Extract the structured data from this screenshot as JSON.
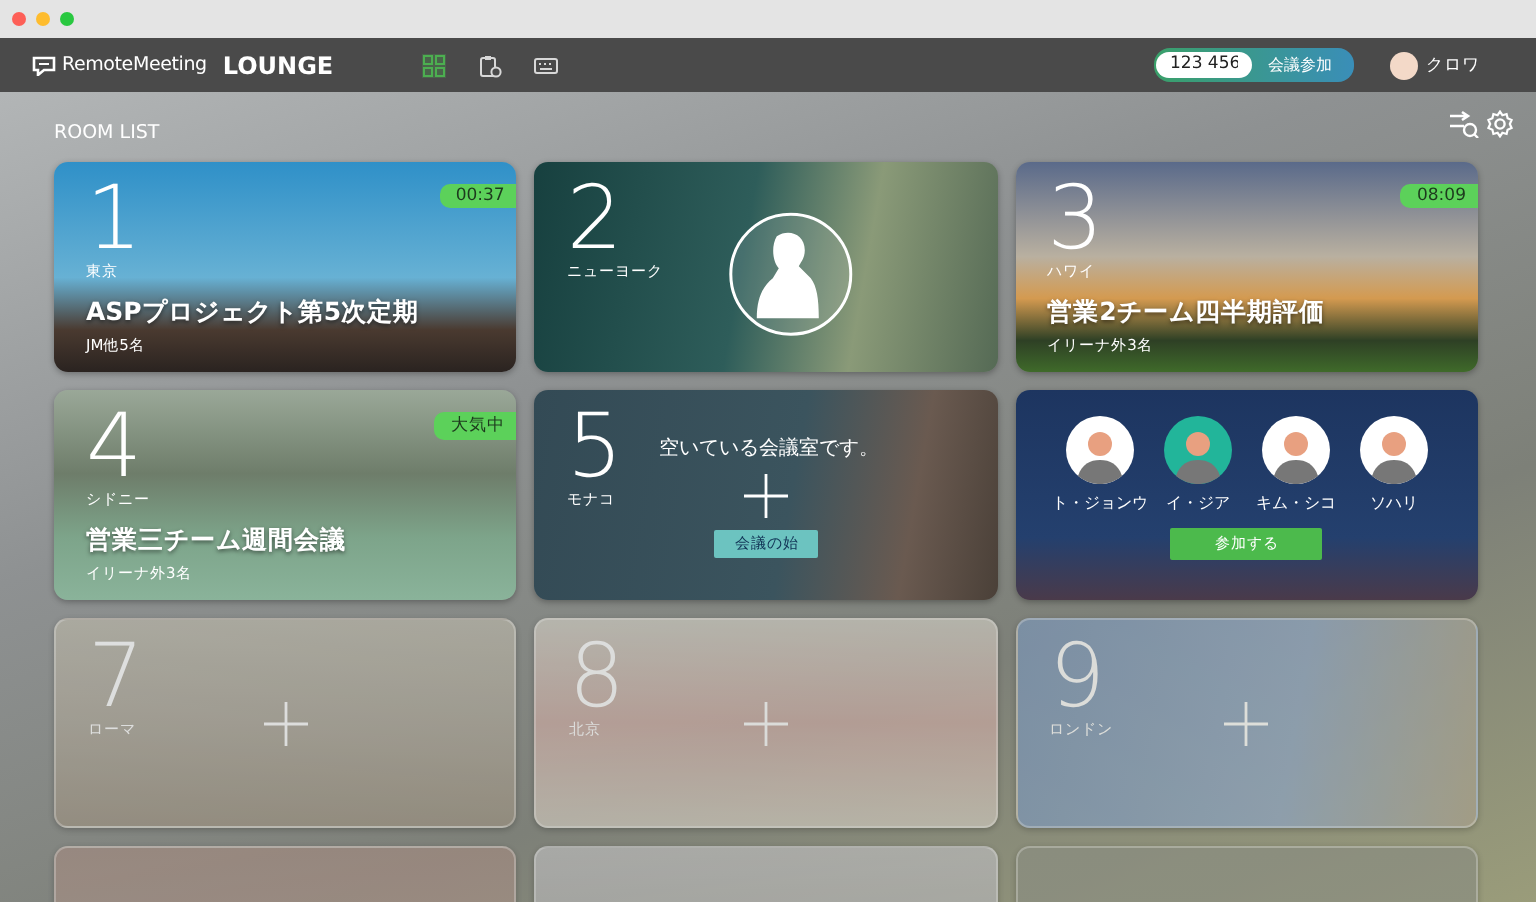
{
  "header": {
    "logo": "RemoteMeeting",
    "app_name": "LOUNGE",
    "nav": [
      {
        "kind": "grid",
        "selected": true
      },
      {
        "kind": "clipboard",
        "selected": false
      },
      {
        "kind": "keyboard",
        "selected": false
      }
    ],
    "meeting_code": "123 456",
    "join_button": "会議参加",
    "user": "クロワ"
  },
  "room_list": {
    "title": "ROOM LIST",
    "rooms": [
      {
        "kind": "active",
        "number": "1",
        "city": "東京",
        "title": "ASPプロジェクト第5次定期",
        "participants": "JM他5名",
        "badge": "00:37"
      },
      {
        "kind": "private",
        "number": "2",
        "city": "ニューヨーク"
      },
      {
        "kind": "active",
        "number": "3",
        "city": "ハワイ",
        "title": "営業2チーム四半期評価",
        "participants": "イリーナ外3名",
        "badge": "08:09"
      },
      {
        "kind": "active",
        "number": "4",
        "city": "シドニー",
        "title": "営業三チーム週間会議",
        "participants": "イリーナ外3名",
        "badge": "大気中"
      },
      {
        "kind": "open",
        "number": "5",
        "city": "モナコ",
        "message": "空いている会議室です。",
        "button": "会議の始"
      },
      {
        "kind": "members",
        "members": [
          {
            "name": "ト・ジョンウ"
          },
          {
            "name": "イ・ジア"
          },
          {
            "name": "キム・シコ"
          },
          {
            "name": "ソハリ"
          }
        ],
        "button": "参加する"
      },
      {
        "kind": "vacant",
        "number": "7",
        "city": "ローマ"
      },
      {
        "kind": "vacant",
        "number": "8",
        "city": "北京"
      },
      {
        "kind": "vacant",
        "number": "9",
        "city": "ロンドン"
      },
      {
        "kind": "vacant"
      },
      {
        "kind": "vacant"
      },
      {
        "kind": "vacant"
      }
    ]
  }
}
